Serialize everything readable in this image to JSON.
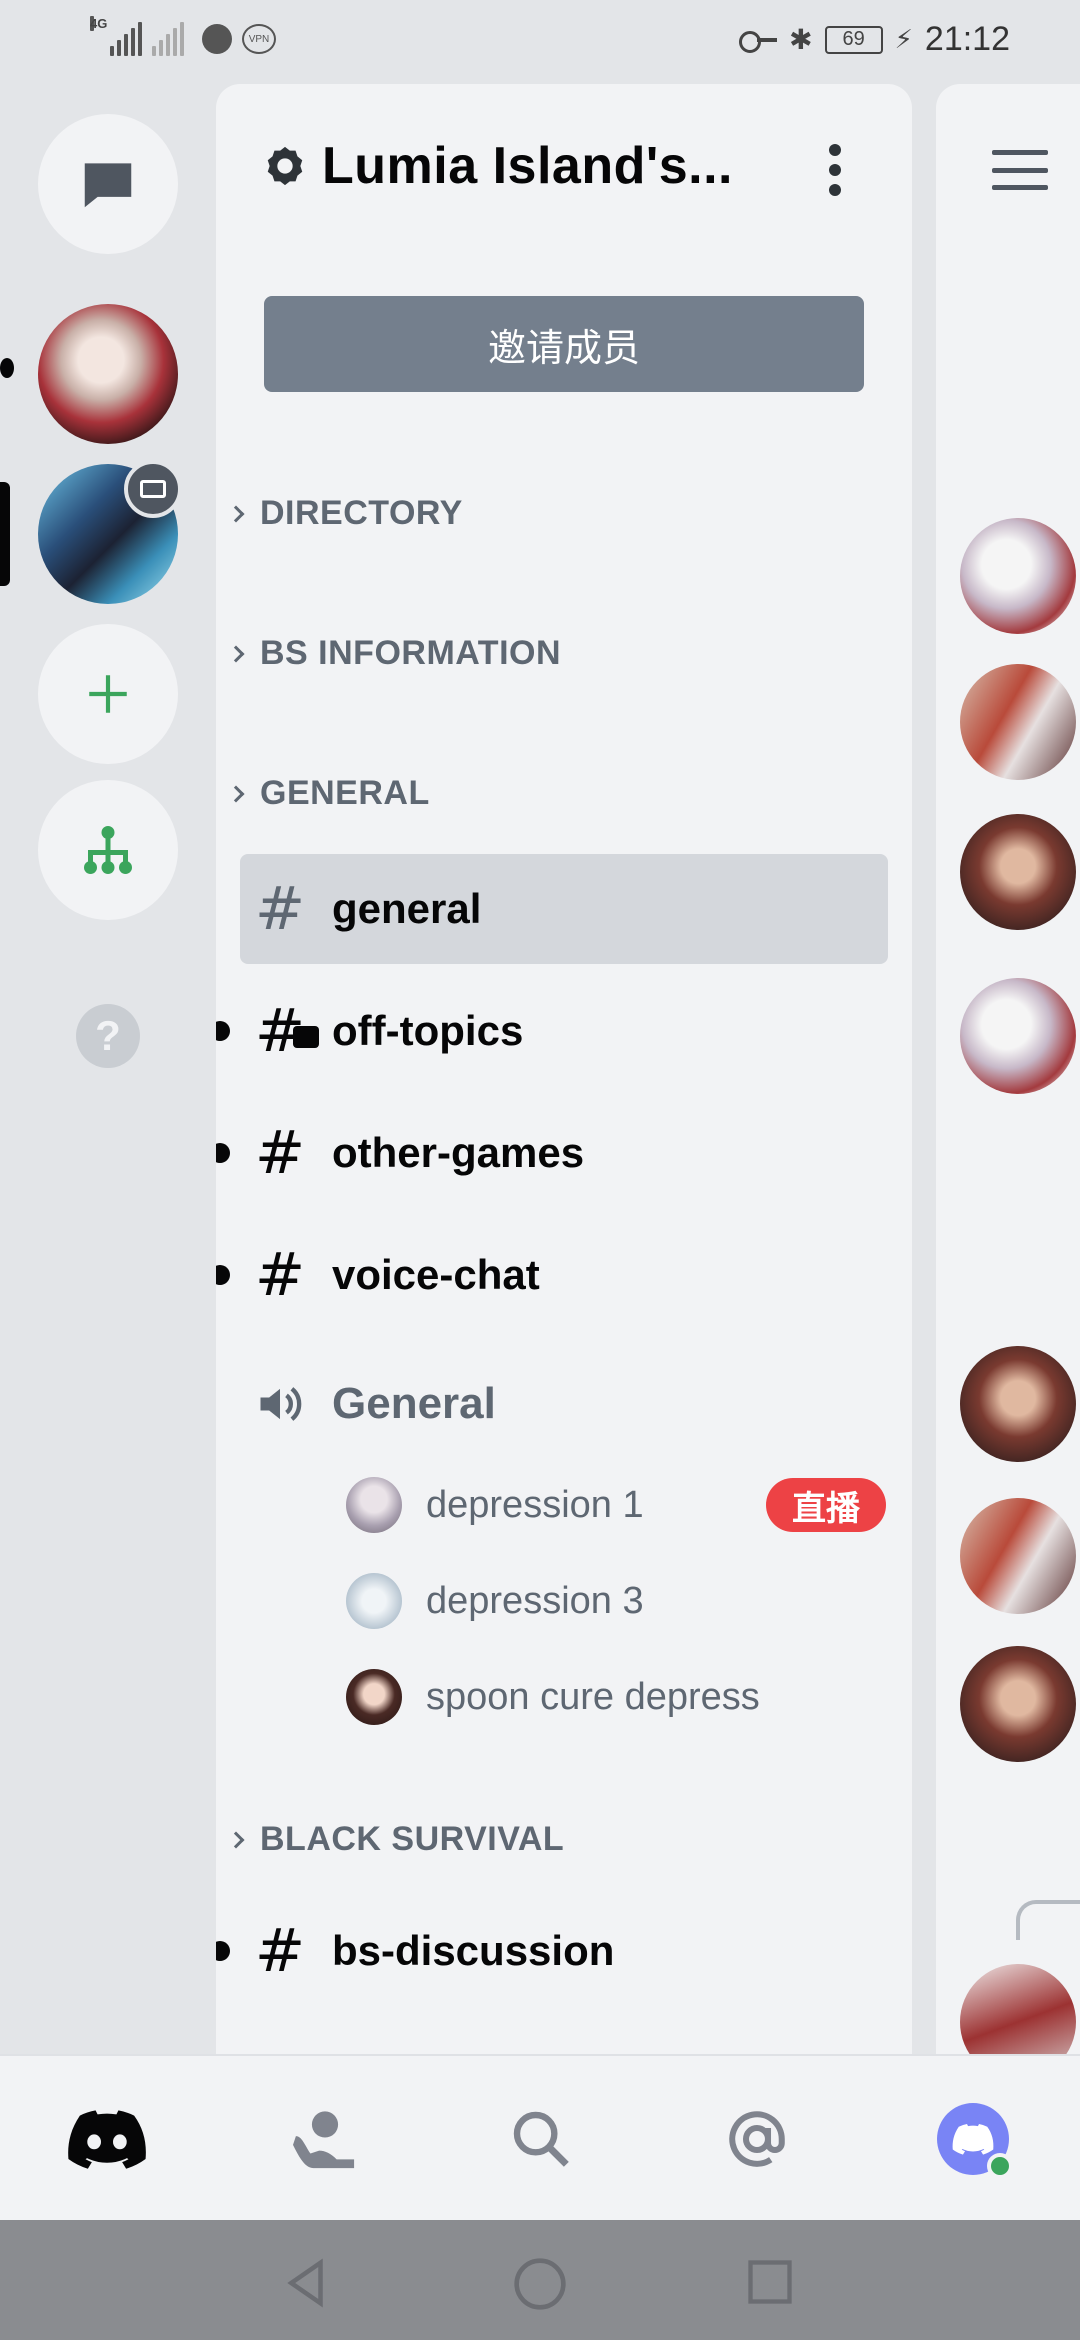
{
  "status_bar": {
    "network_left": "4G",
    "vpn_label": "VPN",
    "battery": "69",
    "time": "21:12"
  },
  "server": {
    "name": "Lumia Island's...",
    "invite_label": "邀请成员"
  },
  "categories": [
    {
      "label": "DIRECTORY"
    },
    {
      "label": "BS INFORMATION"
    },
    {
      "label": "GENERAL"
    },
    {
      "label": "BLACK SURVIVAL"
    }
  ],
  "channels": [
    {
      "name": "general",
      "selected": true,
      "unread": false
    },
    {
      "name": "off-topics",
      "selected": false,
      "unread": true
    },
    {
      "name": "other-games",
      "selected": false,
      "unread": true
    },
    {
      "name": "voice-chat",
      "selected": false,
      "unread": true
    },
    {
      "name": "bs-discussion",
      "selected": false,
      "unread": true
    }
  ],
  "voice_channel": {
    "name": "General",
    "users": [
      {
        "name": "depression 1",
        "live": true
      },
      {
        "name": "depression 3",
        "live": false
      },
      {
        "name": "spoon cure depress",
        "live": false
      }
    ],
    "live_label": "直播"
  },
  "colors": {
    "accent_green": "#3ba55c",
    "blurple": "#5865f2",
    "live_red": "#ed4245",
    "invite_grey": "#747f8d"
  },
  "icons": {
    "rail": [
      "direct-messages-icon",
      "add-server-icon",
      "explore-servers-icon",
      "help-icon"
    ],
    "bottom_nav": [
      "discord-home-icon",
      "friends-icon",
      "search-icon",
      "mentions-icon",
      "profile-avatar"
    ]
  }
}
